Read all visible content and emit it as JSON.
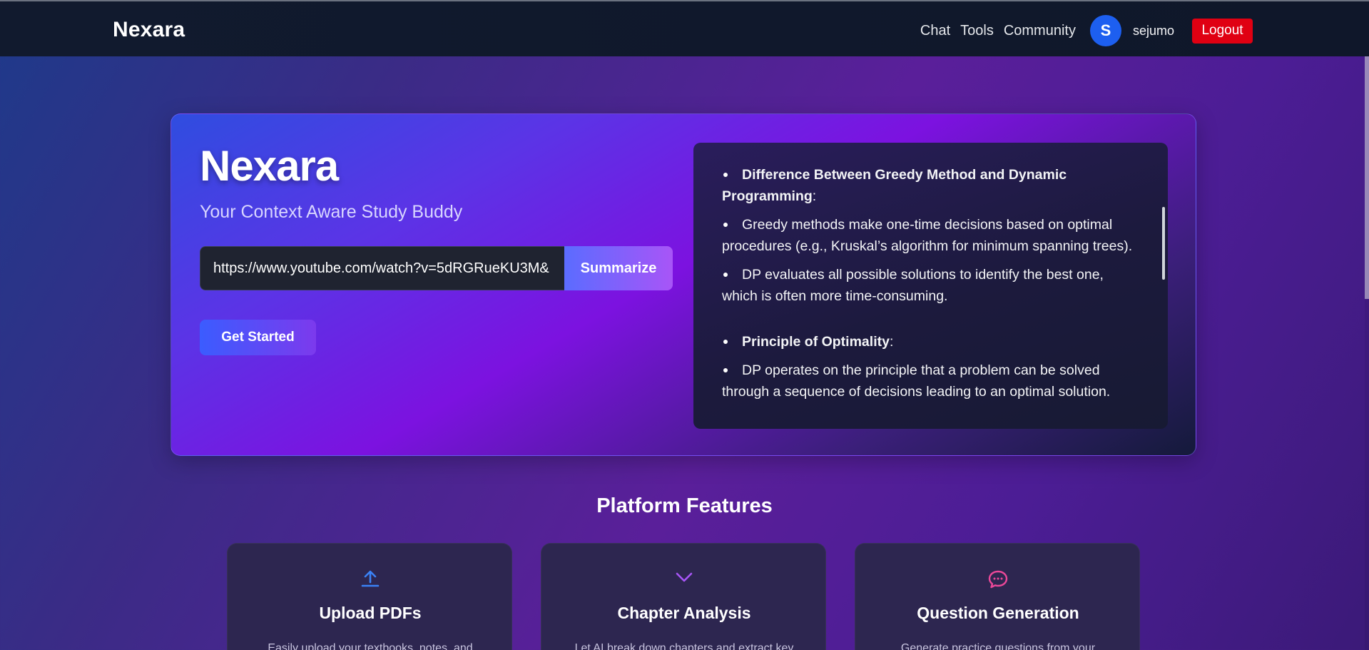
{
  "header": {
    "brand": "Nexara",
    "nav": [
      "Chat",
      "Tools",
      "Community"
    ],
    "avatar_initial": "S",
    "username": "sejumo",
    "logout_label": "Logout"
  },
  "hero": {
    "title": "Nexara",
    "subtitle": "Your Context Aware Study Buddy",
    "url_value": "https://www.youtube.com/watch?v=5dRGRueKU3M&",
    "summarize_label": "Summarize",
    "get_started_label": "Get Started"
  },
  "summary": {
    "items": [
      {
        "bold": "Difference Between Greedy Method and Dynamic Programming",
        "text": ":"
      },
      {
        "bold": "",
        "text": "Greedy methods make one-time decisions based on optimal procedures (e.g., Kruskal’s algorithm for minimum spanning trees)."
      },
      {
        "bold": "",
        "text": "DP evaluates all possible solutions to identify the best one, which is often more time-consuming."
      },
      {
        "bold": "Principle of Optimality",
        "text": ":"
      },
      {
        "bold": "",
        "text": "DP operates on the principle that a problem can be solved through a sequence of decisions leading to an optimal solution."
      }
    ]
  },
  "features": {
    "title": "Platform Features",
    "cards": [
      {
        "icon": "upload-icon",
        "title": "Upload PDFs",
        "desc": "Easily upload your textbooks, notes, and",
        "color": "#3b82f6"
      },
      {
        "icon": "chevron-down-icon",
        "title": "Chapter Analysis",
        "desc": "Let AI break down chapters and extract key",
        "color": "#a855f7"
      },
      {
        "icon": "chat-bubble-icon",
        "title": "Question Generation",
        "desc": "Generate practice questions from your",
        "color": "#ec4899"
      }
    ]
  }
}
